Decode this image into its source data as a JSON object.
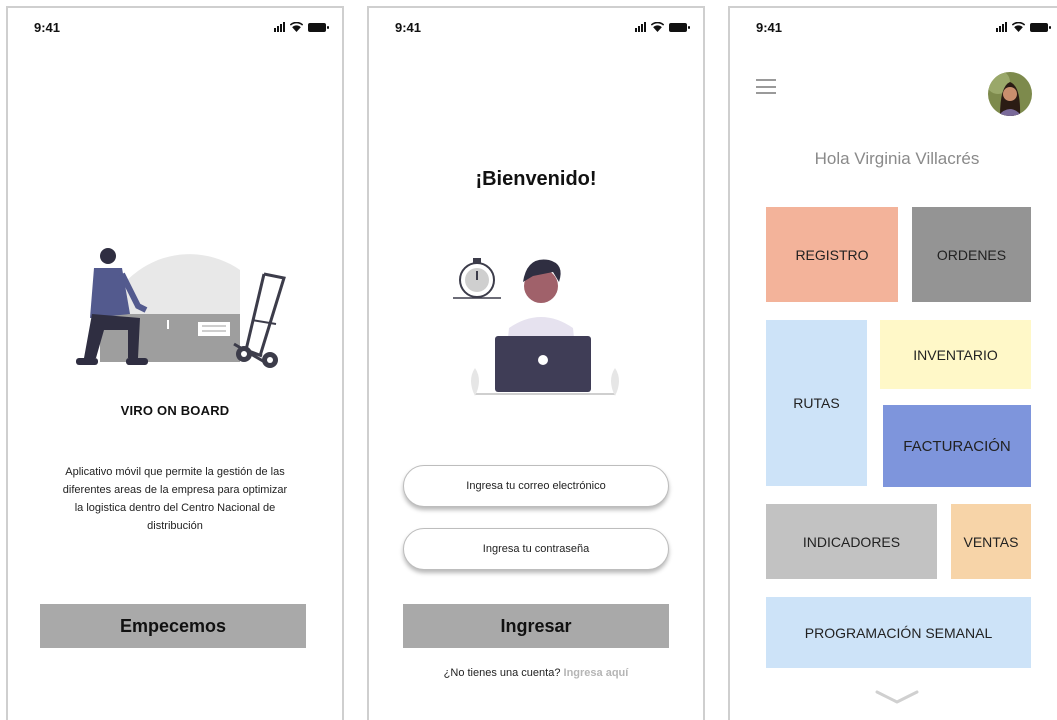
{
  "status": {
    "time": "9:41"
  },
  "screen1": {
    "title": "VIRO ON BOARD",
    "description": "Aplicativo móvil que permite la gestión de las diferentes areas de la empresa para optimizar la logistica dentro del Centro Nacional de distribución",
    "start_button": "Empecemos"
  },
  "screen2": {
    "title": "¡Bienvenido!",
    "email_placeholder": "Ingresa tu correo electrónico",
    "password_placeholder": "Ingresa tu contraseña",
    "login_button": "Ingresar",
    "signup_prompt": "¿No tienes una cuenta?",
    "signup_link": "Ingresa aquí"
  },
  "screen3": {
    "greeting": "Hola Virginia Villacrés",
    "menu_icon": "hamburger-menu-icon",
    "tiles": {
      "registro": "REGISTRO",
      "ordenes": "ORDENES",
      "rutas": "RUTAS",
      "inventario": "INVENTARIO",
      "facturacion": "FACTURACIÓN",
      "indicadores": "INDICADORES",
      "ventas": "VENTAS",
      "programacion": "PROGRAMACIÓN SEMANAL"
    },
    "tile_colors": {
      "registro": "#f3b39a",
      "ordenes": "#949494",
      "rutas": "#cde3f8",
      "inventario": "#fff8c8",
      "facturacion": "#7e95dc",
      "indicadores": "#c2c2c2",
      "ventas": "#f7d4a8",
      "programacion": "#cde3f8"
    }
  }
}
